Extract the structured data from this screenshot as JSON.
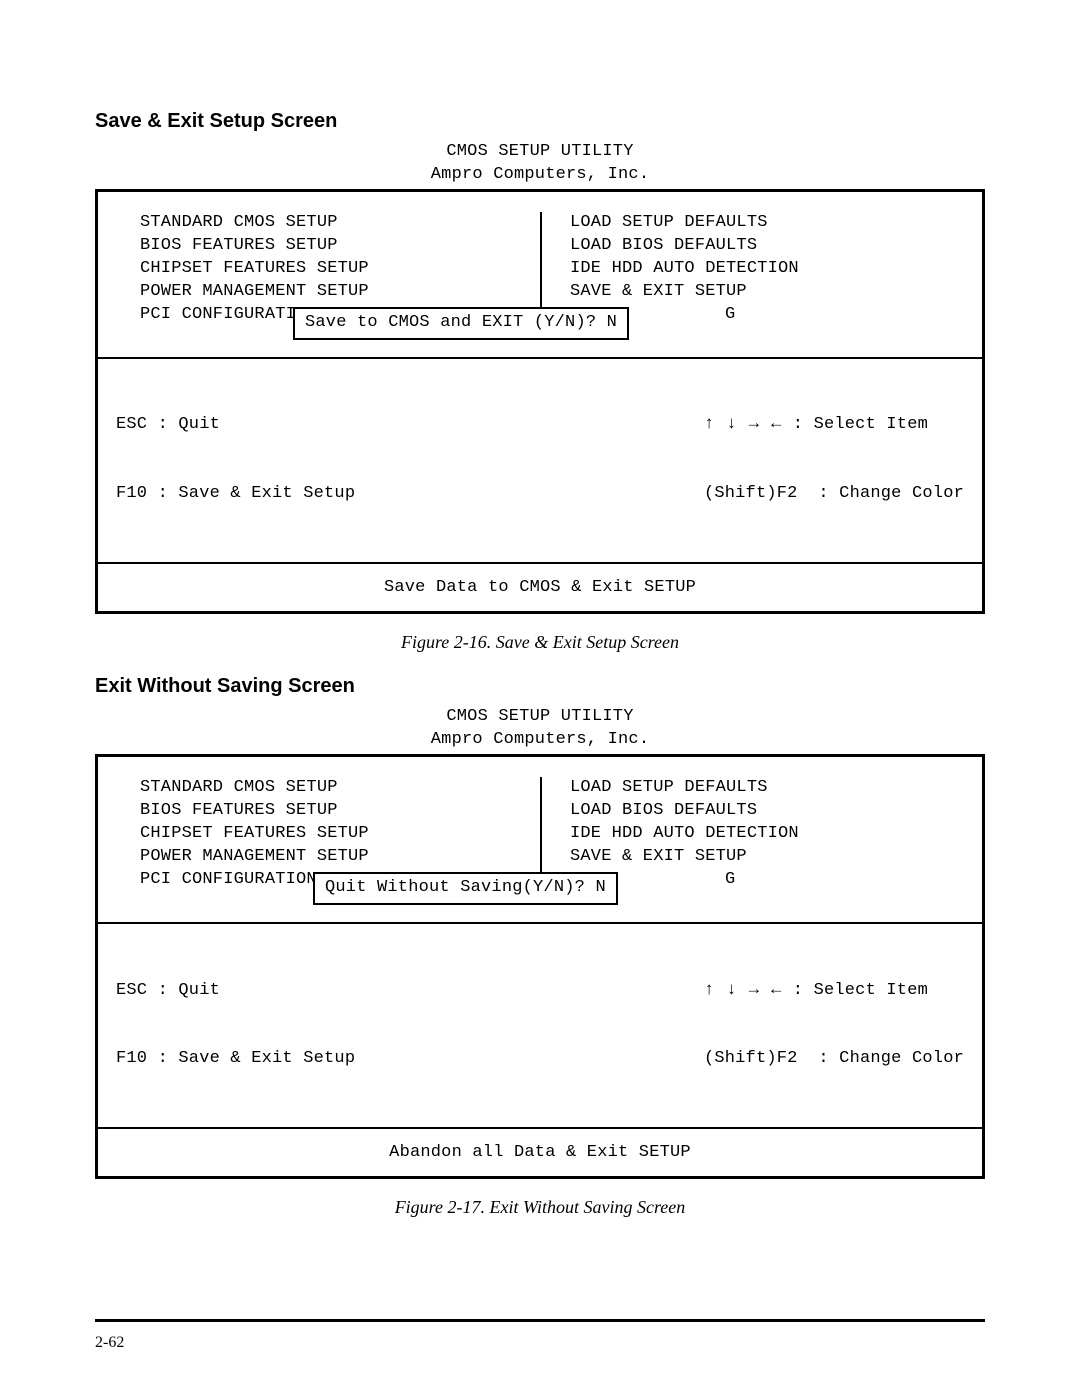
{
  "section1": {
    "heading": "Save & Exit Setup Screen",
    "titleLine1": "CMOS SETUP UTILITY",
    "titleLine2": "Ampro Computers, Inc.",
    "leftMenu": [
      "STANDARD CMOS SETUP",
      "BIOS FEATURES SETUP",
      "CHIPSET FEATURES SETUP",
      "POWER MANAGEMENT SETUP",
      "PCI CONFIGURATION"
    ],
    "rightMenu": [
      "LOAD SETUP DEFAULTS",
      "LOAD BIOS DEFAULTS",
      "IDE HDD AUTO DETECTION",
      "SAVE & EXIT SETUP",
      "G"
    ],
    "dialog": "Save to CMOS and EXIT (Y/N)? N",
    "hints": {
      "escQuit": "ESC : Quit",
      "f10": "F10 : Save & Exit Setup",
      "arrows": "↑ ↓ → ←",
      "selectItem": " : Select Item",
      "shiftF2": "(Shift)F2  : Change Color"
    },
    "footer": "Save Data to CMOS & Exit SETUP",
    "caption": "Figure 2-16.  Save & Exit Setup Screen"
  },
  "section2": {
    "heading": "Exit Without Saving Screen",
    "titleLine1": "CMOS SETUP UTILITY",
    "titleLine2": "Ampro Computers, Inc.",
    "leftMenu": [
      "STANDARD CMOS SETUP",
      "BIOS FEATURES SETUP",
      "CHIPSET FEATURES SETUP",
      "POWER MANAGEMENT SETUP",
      "PCI CONFIGURATION"
    ],
    "rightMenu": [
      "LOAD SETUP DEFAULTS",
      "LOAD BIOS DEFAULTS",
      "IDE HDD AUTO DETECTION",
      "SAVE & EXIT SETUP",
      "G"
    ],
    "dialog": "Quit Without Saving(Y/N)? N",
    "hints": {
      "escQuit": "ESC : Quit",
      "f10": "F10 : Save & Exit Setup",
      "arrows": "↑ ↓ → ←",
      "selectItem": " : Select Item",
      "shiftF2": "(Shift)F2  : Change Color"
    },
    "footer": "Abandon all Data & Exit SETUP",
    "caption": "Figure 2-17.  Exit Without Saving Screen"
  },
  "pageNumber": "2-62"
}
